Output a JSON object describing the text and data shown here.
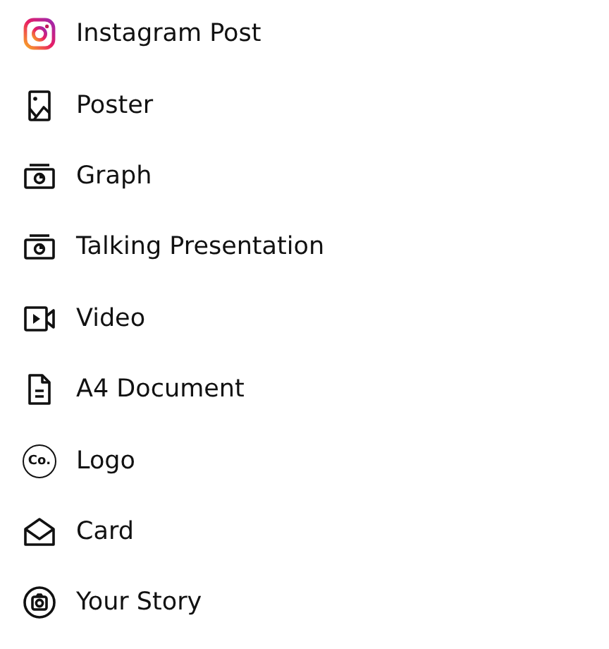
{
  "items": [
    {
      "kind": "instagram",
      "label": "Instagram Post"
    },
    {
      "kind": "poster",
      "label": "Poster"
    },
    {
      "kind": "graph",
      "label": "Graph"
    },
    {
      "kind": "graph",
      "label": "Talking Presentation"
    },
    {
      "kind": "video",
      "label": "Video"
    },
    {
      "kind": "document",
      "label": "A4 Document"
    },
    {
      "kind": "logo",
      "label": "Logo",
      "icon_text": "Co."
    },
    {
      "kind": "card",
      "label": "Card"
    },
    {
      "kind": "story",
      "label": "Your Story"
    }
  ]
}
